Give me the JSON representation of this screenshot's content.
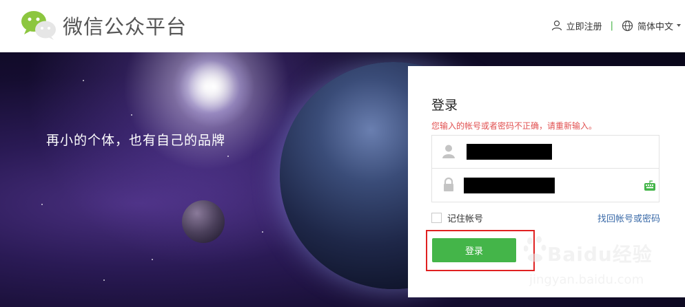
{
  "header": {
    "site_title": "微信公众平台",
    "register_label": "立即注册",
    "separator": "|",
    "language_label": "简体中文",
    "brand_green": "#44b549"
  },
  "banner": {
    "slogan": "再小的个体，也有自己的品牌"
  },
  "login": {
    "title": "登录",
    "error_message": "您输入的帐号或者密码不正确，请重新输入。",
    "username_icon": "user-icon",
    "password_icon": "lock-icon",
    "keyboard_icon": "keyboard-icon",
    "remember_label": "记住帐号",
    "forgot_label": "找回帐号或密码",
    "submit_label": "登录",
    "error_color": "#e15050",
    "button_color": "#44b549"
  },
  "watermark": {
    "brand": "Baidu经验",
    "url": "jingyan.baidu.com"
  }
}
